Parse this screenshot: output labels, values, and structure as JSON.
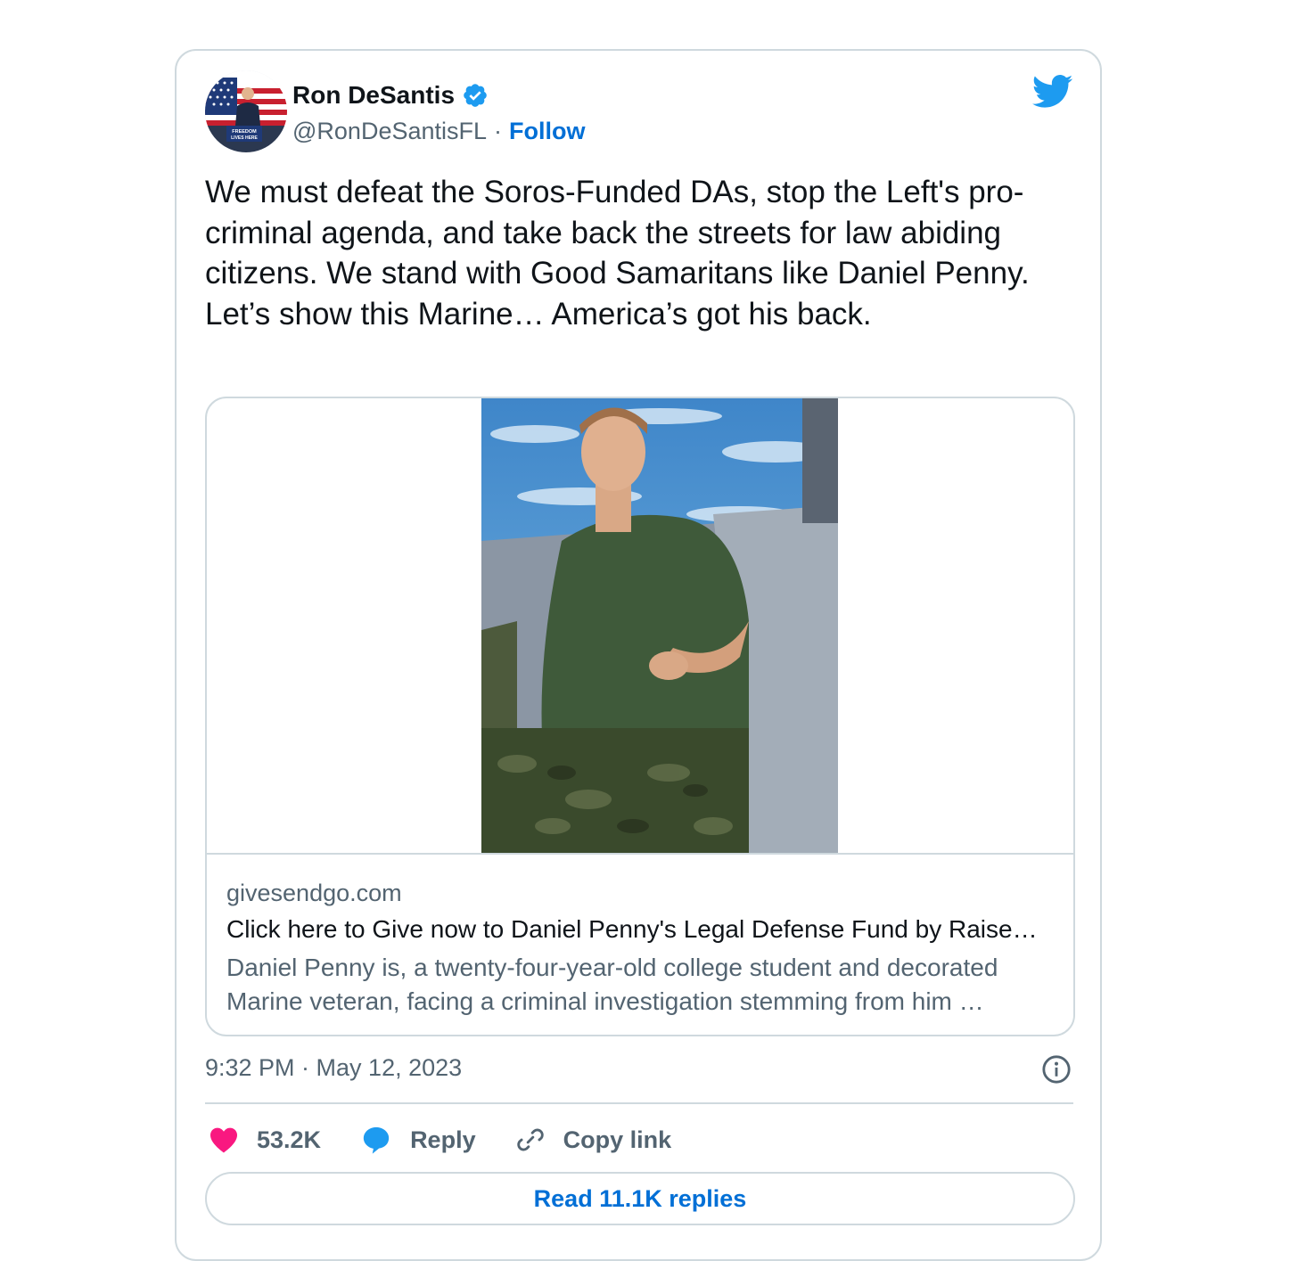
{
  "author": {
    "name": "Ron DeSantis",
    "handle": "@RonDeSantisFL",
    "separator": "·",
    "follow_label": "Follow",
    "avatar_sign_line1": "FREEDOM",
    "avatar_sign_line2": "LIVES HERE"
  },
  "tweet": {
    "text": "We must defeat the Soros-Funded DAs, stop the Left's pro-criminal agenda, and take back the streets for law abiding citizens. We stand with Good Samaritans like Daniel Penny. Let’s show this Marine… America’s got his back.",
    "timestamp": "9:32 PM · May 12, 2023"
  },
  "link_card": {
    "domain": "givesendgo.com",
    "title": "Click here to Give now to Daniel Penny's Legal Defense Fund by Raise…",
    "description": "Daniel Penny is, a twenty-four-year-old college student and decorated Marine veteran, facing a criminal investigation stemming from him …"
  },
  "actions": {
    "likes": "53.2K",
    "reply_label": "Reply",
    "copy_label": "Copy link"
  },
  "read_replies_label": "Read 11.1K replies",
  "icons": [
    "verified-badge-icon",
    "twitter-bird-icon",
    "info-icon",
    "heart-icon",
    "reply-bubble-icon",
    "link-icon"
  ],
  "colors": {
    "twitter_blue": "#1d9bf0",
    "link_blue": "#006fd6",
    "like_pink": "#f91880",
    "muted_text": "#536471",
    "border": "#cfd9de"
  }
}
